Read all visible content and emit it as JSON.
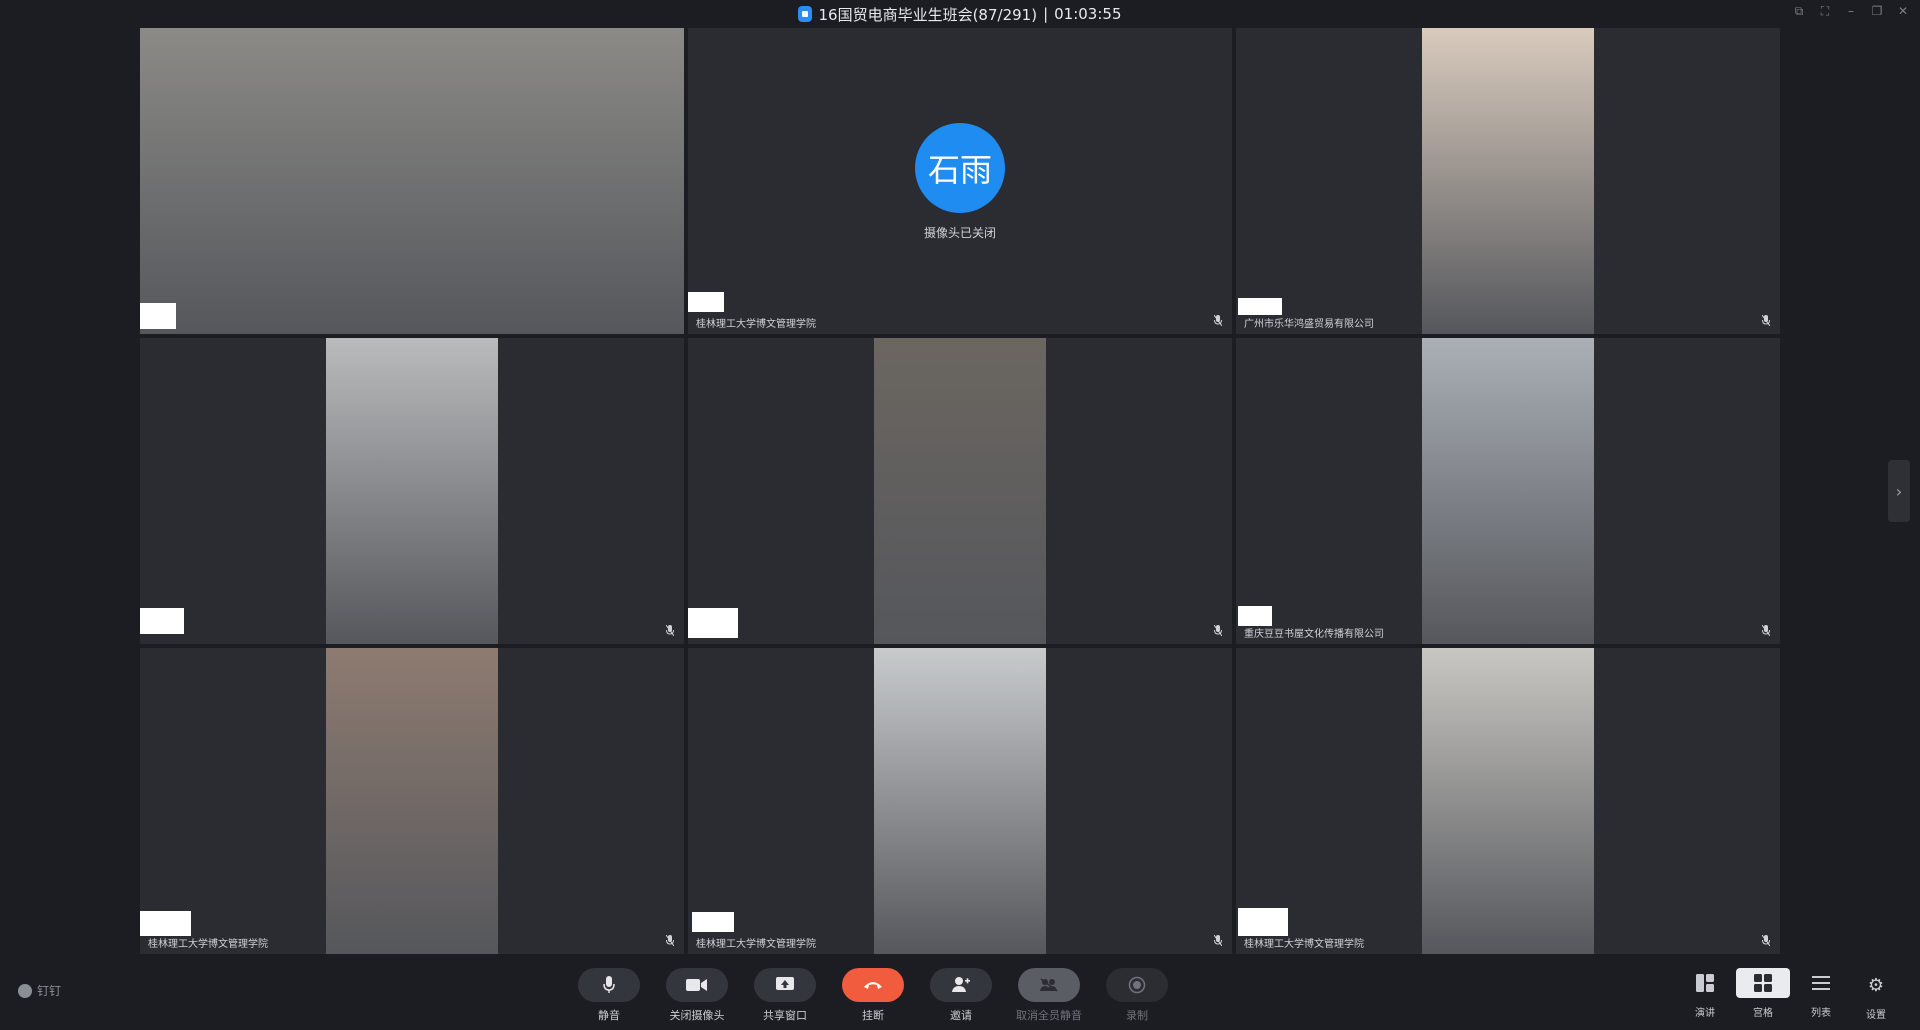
{
  "window": {
    "title": "16国贸电商毕业生班会(87/291)",
    "separator": "|",
    "elapsed": "01:03:55"
  },
  "tiles": [
    {
      "org": "",
      "video": true,
      "video_color": "#8b8a86"
    },
    {
      "org": "桂林理工大学博文管理学院",
      "video": false,
      "avatar_text": "石雨",
      "camera_status": "摄像头已关闭"
    },
    {
      "org": "广州市乐华鸿盛贸易有限公司",
      "video": true,
      "video_color": "#d9cbbd"
    },
    {
      "org": "",
      "video": true,
      "video_color": "#b9bbbc"
    },
    {
      "org": "",
      "video": true,
      "video_color": "#6b6660"
    },
    {
      "org": "重庆豆豆书屋文化传播有限公司",
      "video": true,
      "video_color": "#aab0b6"
    },
    {
      "org": "桂林理工大学博文管理学院",
      "video": true,
      "video_color": "#8e7b70"
    },
    {
      "org": "桂林理工大学博文管理学院",
      "video": true,
      "video_color": "#c8cbcc"
    },
    {
      "org": "桂林理工大学博文管理学院",
      "video": true,
      "video_color": "#c9c7c2"
    }
  ],
  "toolbar": {
    "pin_label": "钉钉",
    "mute": "静音",
    "camera_off": "关闭摄像头",
    "share_window": "共享窗口",
    "hang_up": "挂断",
    "invite": "邀请",
    "unmute_all": "取消全员静音",
    "record": "录制"
  },
  "views": {
    "speaker": "演讲",
    "grid": "宫格",
    "list": "列表",
    "settings": "设置"
  },
  "colors": {
    "hangup": "#f15c3f",
    "avatar": "#1f8cf2",
    "tile_bg": "#2a2c31"
  }
}
